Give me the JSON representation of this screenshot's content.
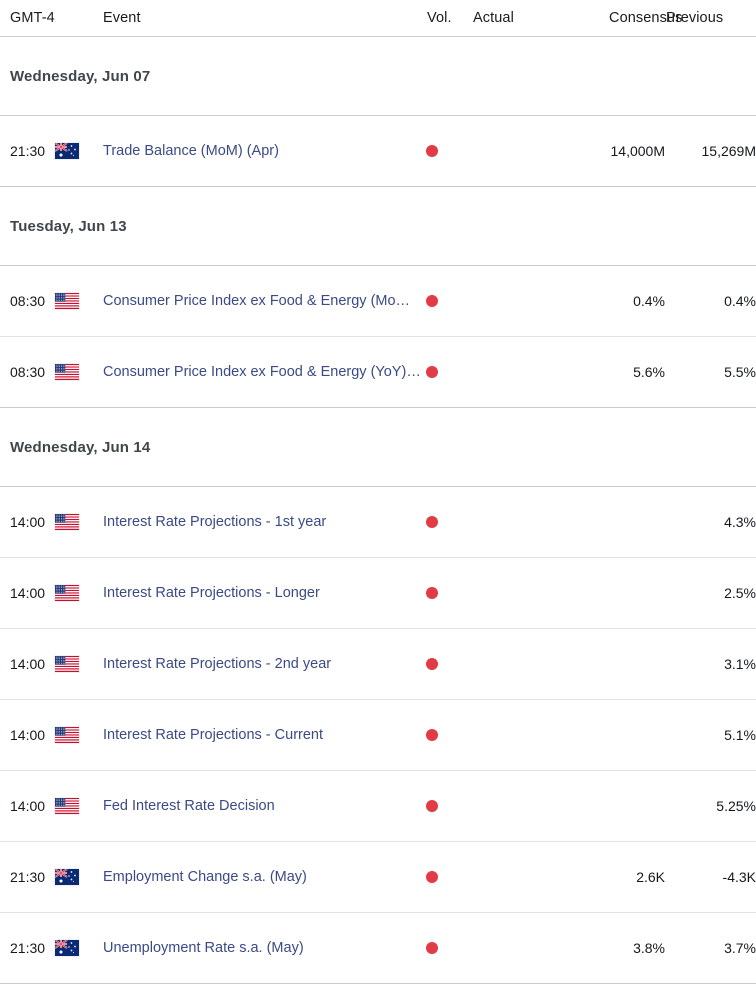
{
  "header": {
    "timezone": "GMT-4",
    "event": "Event",
    "vol": "Vol.",
    "actual": "Actual",
    "consensus": "Consensus",
    "previous": "Previous"
  },
  "colors": {
    "event_link": "#3b4a86",
    "volatility_high": "#e23b47",
    "day_header": "#41464c",
    "rule": "#c9cdd1"
  },
  "days": [
    {
      "label": "Wednesday, Jun 07",
      "rows": [
        {
          "time": "21:30",
          "flag": "flag-au",
          "country": "Australia",
          "event": "Trade Balance (MoM) (Apr)",
          "volatility": "high",
          "volatility_icon": "red-dot-icon",
          "actual": "",
          "consensus": "14,000M",
          "previous": "15,269M"
        }
      ]
    },
    {
      "label": "Tuesday, Jun 13",
      "rows": [
        {
          "time": "08:30",
          "flag": "flag-us",
          "country": "United States",
          "event": "Consumer Price Index ex Food & Energy (MoM) (May)",
          "volatility": "high",
          "volatility_icon": "red-dot-icon",
          "actual": "",
          "consensus": "0.4%",
          "previous": "0.4%"
        },
        {
          "time": "08:30",
          "flag": "flag-us",
          "country": "United States",
          "event": "Consumer Price Index ex Food & Energy (YoY) (May)",
          "volatility": "high",
          "volatility_icon": "red-dot-icon",
          "actual": "",
          "consensus": "5.6%",
          "previous": "5.5%"
        }
      ]
    },
    {
      "label": "Wednesday, Jun 14",
      "rows": [
        {
          "time": "14:00",
          "flag": "flag-us",
          "country": "United States",
          "event": "Interest Rate Projections - 1st year",
          "volatility": "high",
          "volatility_icon": "red-dot-icon",
          "actual": "",
          "consensus": "",
          "previous": "4.3%"
        },
        {
          "time": "14:00",
          "flag": "flag-us",
          "country": "United States",
          "event": "Interest Rate Projections - Longer",
          "volatility": "high",
          "volatility_icon": "red-dot-icon",
          "actual": "",
          "consensus": "",
          "previous": "2.5%"
        },
        {
          "time": "14:00",
          "flag": "flag-us",
          "country": "United States",
          "event": "Interest Rate Projections - 2nd year",
          "volatility": "high",
          "volatility_icon": "red-dot-icon",
          "actual": "",
          "consensus": "",
          "previous": "3.1%"
        },
        {
          "time": "14:00",
          "flag": "flag-us",
          "country": "United States",
          "event": "Interest Rate Projections - Current",
          "volatility": "high",
          "volatility_icon": "red-dot-icon",
          "actual": "",
          "consensus": "",
          "previous": "5.1%"
        },
        {
          "time": "14:00",
          "flag": "flag-us",
          "country": "United States",
          "event": "Fed Interest Rate Decision",
          "volatility": "high",
          "volatility_icon": "red-dot-icon",
          "actual": "",
          "consensus": "",
          "previous": "5.25%"
        },
        {
          "time": "21:30",
          "flag": "flag-au",
          "country": "Australia",
          "event": "Employment Change s.a. (May)",
          "volatility": "high",
          "volatility_icon": "red-dot-icon",
          "actual": "",
          "consensus": "2.6K",
          "previous": "-4.3K"
        },
        {
          "time": "21:30",
          "flag": "flag-au",
          "country": "Australia",
          "event": "Unemployment Rate s.a. (May)",
          "volatility": "high",
          "volatility_icon": "red-dot-icon",
          "actual": "",
          "consensus": "3.8%",
          "previous": "3.7%"
        }
      ]
    }
  ]
}
